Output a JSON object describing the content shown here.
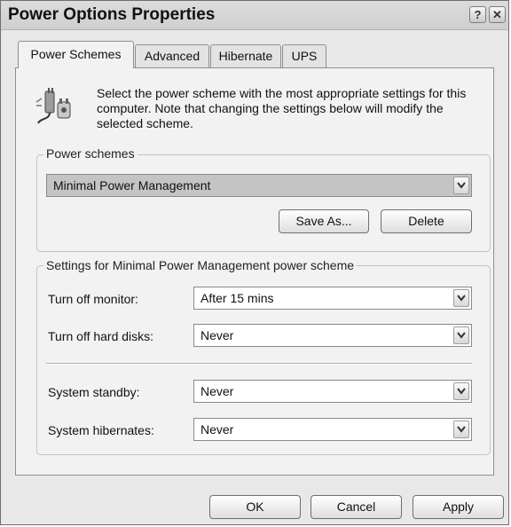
{
  "window": {
    "title": "Power Options Properties"
  },
  "titlebar_buttons": {
    "help": "?",
    "close": "✕"
  },
  "tabs": [
    {
      "label": "Power Schemes",
      "active": true
    },
    {
      "label": "Advanced",
      "active": false
    },
    {
      "label": "Hibernate",
      "active": false
    },
    {
      "label": "UPS",
      "active": false
    }
  ],
  "intro": {
    "icon": "power-plug-icon",
    "text": "Select the power scheme with the most appropriate settings for this computer. Note that changing the settings below will modify the selected scheme."
  },
  "power_schemes": {
    "legend": "Power schemes",
    "selected": "Minimal Power Management",
    "save_as_label": "Save As...",
    "delete_label": "Delete"
  },
  "settings": {
    "legend": "Settings for Minimal Power Management power scheme",
    "rows": [
      {
        "label": "Turn off monitor:",
        "value": "After 15 mins"
      },
      {
        "label": "Turn off hard disks:",
        "value": "Never"
      },
      {
        "label": "System standby:",
        "value": "Never"
      },
      {
        "label": "System hibernates:",
        "value": "Never"
      }
    ]
  },
  "footer": {
    "ok_label": "OK",
    "cancel_label": "Cancel",
    "apply_label": "Apply"
  }
}
